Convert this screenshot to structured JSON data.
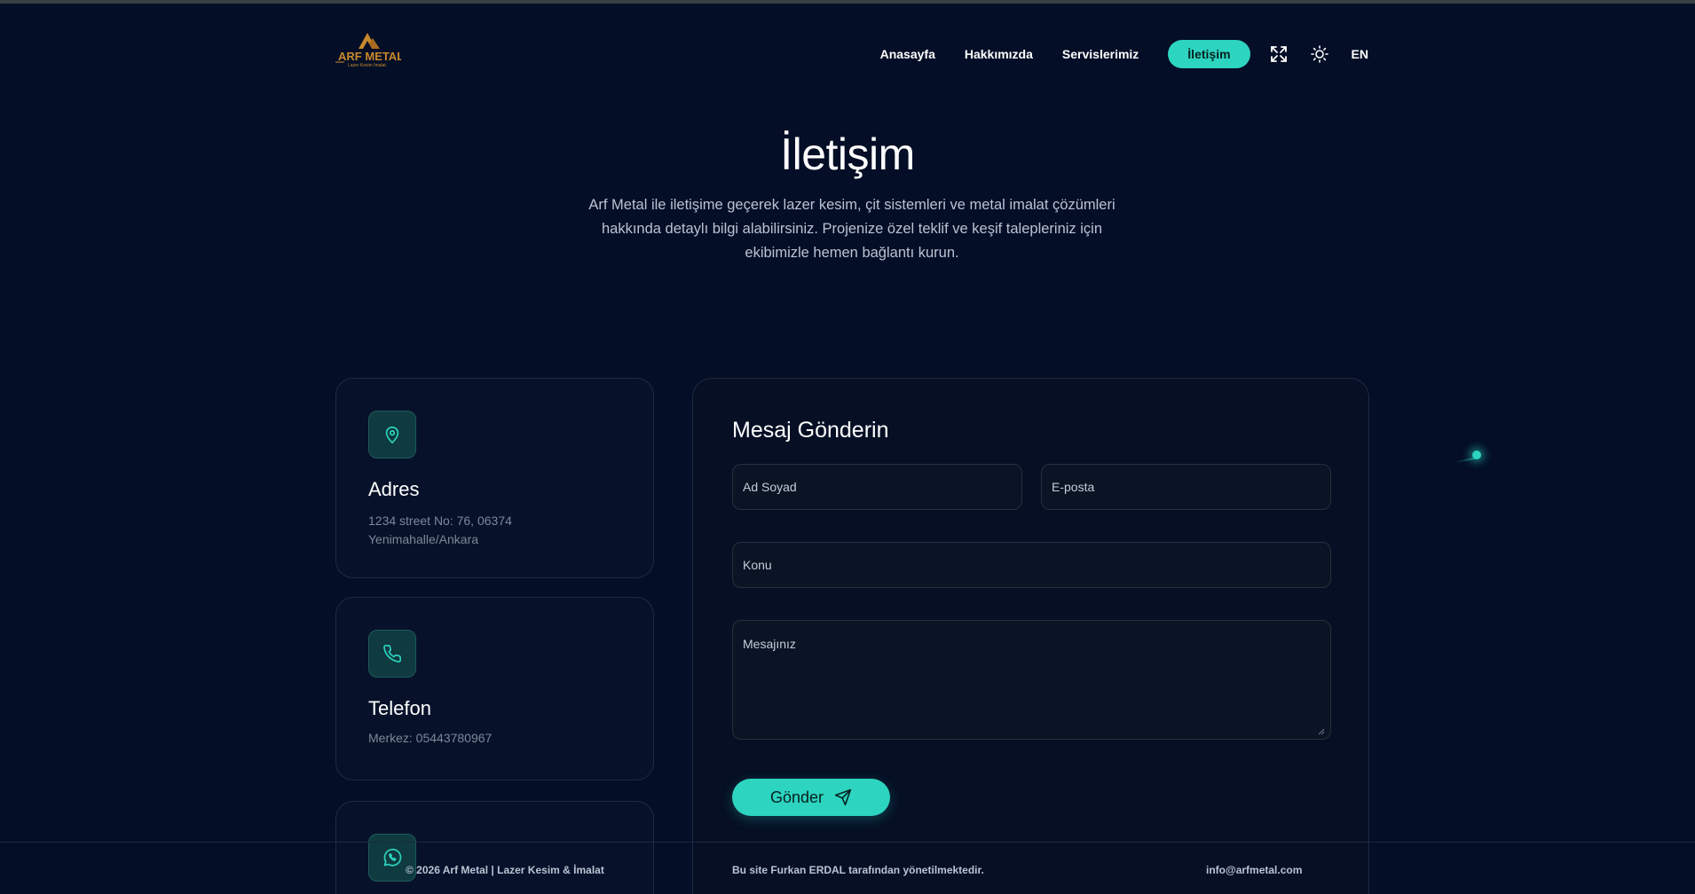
{
  "nav": {
    "logo_text": "ARF METAL",
    "logo_subtext": "Lazer Kesim İmalat",
    "links": [
      "Anasayfa",
      "Hakkımızda",
      "Servislerimiz"
    ],
    "active": "İletişim",
    "fullscreen_icon": "expand-icon",
    "theme_icon": "sun-icon",
    "lang": "EN"
  },
  "hero": {
    "title": "İletişim",
    "description": "Arf Metal ile iletişime geçerek lazer kesim, çit sistemleri ve metal imalat çözümleri hakkında detaylı bilgi alabilirsiniz. Projenize özel teklif ve keşif talepleriniz için ekibimizle hemen bağlantı kurun."
  },
  "cards": [
    {
      "icon": "location-pin-icon",
      "title": "Adres",
      "text": "1234 street No: 76, 06374 Yenimahalle/Ankara"
    },
    {
      "icon": "phone-icon",
      "title": "Telefon",
      "text": "Merkez: 05443780967"
    },
    {
      "icon": "whatsapp-icon",
      "title": "",
      "text": ""
    }
  ],
  "form": {
    "title": "Mesaj Gönderin",
    "name_placeholder": "Ad Soyad",
    "email_placeholder": "E-posta",
    "subject_placeholder": "Konu",
    "message_placeholder": "Mesajınız",
    "submit_label": "Gönder",
    "submit_icon": "send-icon"
  },
  "footer": {
    "copyright": "© 2026 Arf Metal | Lazer Kesim & İmalat",
    "managed_by": "Bu site Furkan ERDAL tarafından yönetilmektedir.",
    "email": "info@arfmetal.com"
  },
  "colors": {
    "background": "#040e26",
    "accent": "#2dd4bf",
    "card_border": "#1e2b3f",
    "logo_gold": "#c8892c"
  }
}
